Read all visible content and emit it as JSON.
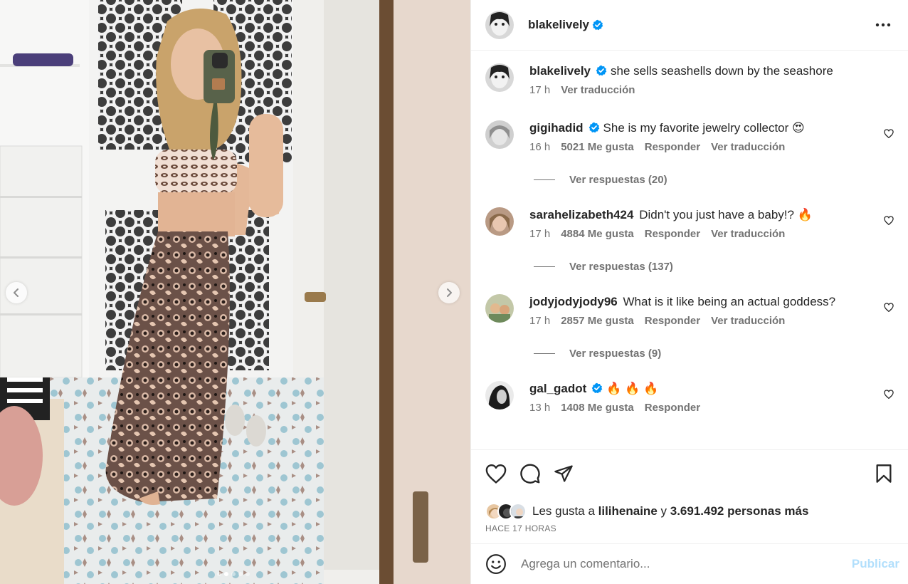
{
  "post": {
    "author": "blakelively",
    "verified_icon": "verified-badge-icon",
    "more_icon": "more-options-icon"
  },
  "caption": {
    "username": "blakelively",
    "text": "she sells seashells down by the seashore",
    "time": "17 h",
    "translate": "Ver traducción"
  },
  "comments": [
    {
      "username": "gigihadid",
      "verified": true,
      "text": "She is my favorite jewelry collector 😍",
      "time": "16 h",
      "likes": "5021 Me gusta",
      "reply": "Responder",
      "translate": "Ver traducción",
      "replies": "Ver respuestas (20)"
    },
    {
      "username": "sarahelizabeth424",
      "verified": false,
      "text": "Didn't you just have a baby!? 🔥",
      "time": "17 h",
      "likes": "4884 Me gusta",
      "reply": "Responder",
      "translate": "Ver traducción",
      "replies": "Ver respuestas (137)"
    },
    {
      "username": "jodyjodyjody96",
      "verified": false,
      "text": "What is it like being an actual goddess?",
      "time": "17 h",
      "likes": "2857 Me gusta",
      "reply": "Responder",
      "translate": "Ver traducción",
      "replies": "Ver respuestas (9)"
    },
    {
      "username": "gal_gadot",
      "verified": true,
      "text": "🔥 🔥 🔥",
      "time": "13 h",
      "likes": "1408 Me gusta",
      "reply": "Responder"
    }
  ],
  "likes_line": {
    "prefix": "Les gusta a",
    "user": "lilihenaine",
    "conj": "y",
    "count": "3.691.492 personas más"
  },
  "posted_ago": "HACE 17 HORAS",
  "composer": {
    "placeholder": "Agrega un comentario...",
    "publish": "Publicar"
  },
  "carousel": {
    "slides": 5,
    "current": 1
  },
  "colors": {
    "verified": "#0095f6",
    "publish_disabled": "#b2dffc",
    "secondary_text": "#737373"
  }
}
